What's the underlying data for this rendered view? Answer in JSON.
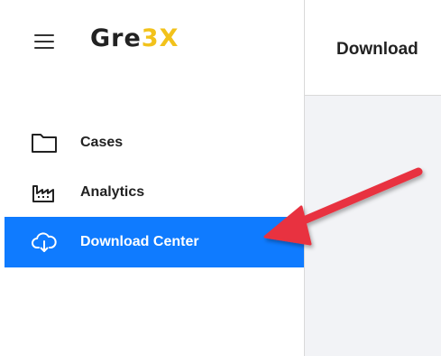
{
  "brand": {
    "logo_part1": "Gre",
    "logo_part2": "3X",
    "accent": "#f2c21b"
  },
  "sidebar": {
    "menu_icon": "hamburger-menu-icon",
    "items": [
      {
        "label": "Cases",
        "icon": "folder-icon"
      },
      {
        "label": "Analytics",
        "icon": "factory-icon"
      },
      {
        "label": "Download Center",
        "icon": "cloud-download-icon",
        "active": true
      }
    ],
    "active_color": "#0f7bff"
  },
  "main": {
    "title": "Download"
  },
  "annotation": {
    "arrow_color": "#e8333f"
  }
}
